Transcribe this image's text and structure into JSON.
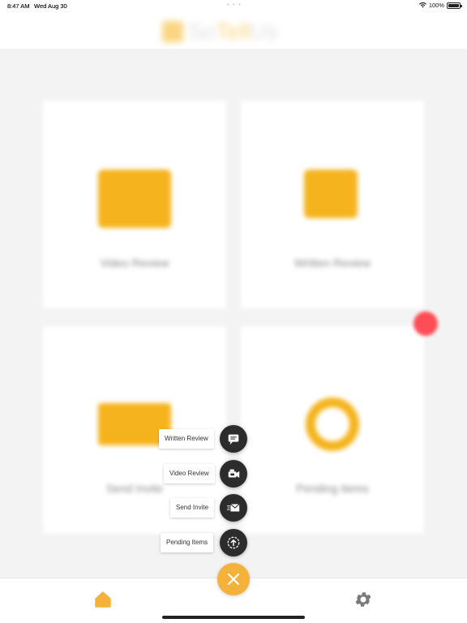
{
  "status_bar": {
    "time": "8:47 AM",
    "date": "Wed Aug 30",
    "dots": "• • •",
    "battery": "100%"
  },
  "header": {
    "logo_text_a": "So",
    "logo_text_b": "Tell",
    "logo_text_c": "Us"
  },
  "cards": [
    {
      "label": "Video Review",
      "icon": "video-camera-icon"
    },
    {
      "label": "Written Review",
      "icon": "written-review-icon"
    },
    {
      "label": "Send Invite",
      "icon": "envelope-icon"
    },
    {
      "label": "Pending Items",
      "icon": "pending-items-icon"
    }
  ],
  "fab_menu": {
    "items": [
      {
        "label": "Written Review",
        "icon": "written-review-icon"
      },
      {
        "label": "Video Review",
        "icon": "video-camera-icon"
      },
      {
        "label": "Send Invite",
        "icon": "send-envelope-icon"
      },
      {
        "label": "Pending Items",
        "icon": "pending-upload-icon"
      }
    ],
    "close_icon": "close-icon"
  },
  "tab_bar": {
    "items": [
      {
        "name": "home",
        "icon": "home-icon"
      },
      {
        "name": "settings",
        "icon": "gear-icon"
      }
    ]
  },
  "colors": {
    "accent": "#f5b23a",
    "fab_dark": "#2c2c2c",
    "notification_red": "#ff3b45"
  }
}
